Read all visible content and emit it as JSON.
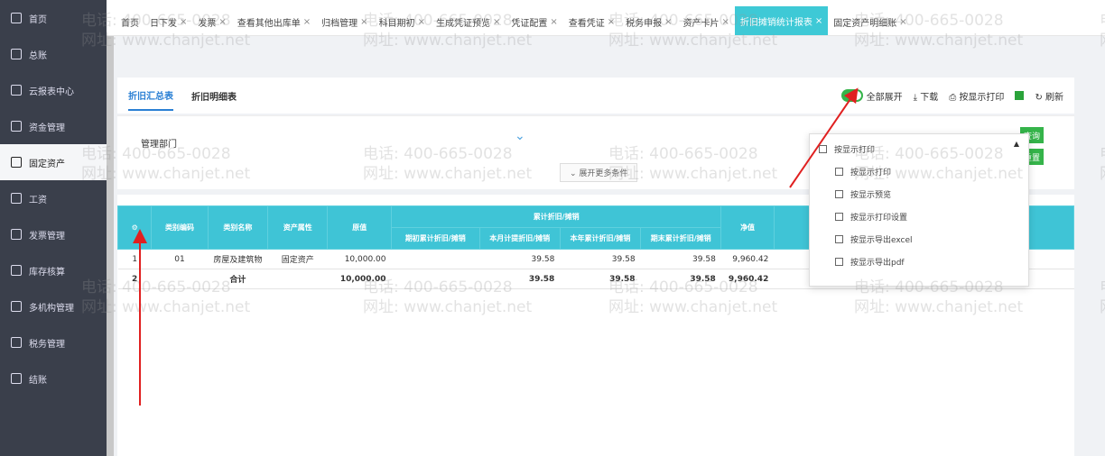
{
  "sidebar": {
    "items": [
      {
        "label": "首页",
        "icon": "home-icon",
        "active": false
      },
      {
        "label": "总账",
        "icon": "ledger-icon",
        "active": false
      },
      {
        "label": "云报表中心",
        "icon": "chart-icon",
        "active": false
      },
      {
        "label": "资金管理",
        "icon": "money-icon",
        "active": false
      },
      {
        "label": "固定资产",
        "icon": "asset-icon",
        "active": true
      },
      {
        "label": "工资",
        "icon": "salary-icon",
        "active": false
      },
      {
        "label": "发票管理",
        "icon": "invoice-icon",
        "active": false
      },
      {
        "label": "库存核算",
        "icon": "warehouse-icon",
        "active": false
      },
      {
        "label": "多机构管理",
        "icon": "org-icon",
        "active": false
      },
      {
        "label": "税务管理",
        "icon": "tax-icon",
        "active": false
      },
      {
        "label": "结账",
        "icon": "close-books-icon",
        "active": false
      }
    ]
  },
  "tabs": [
    {
      "label": "首页",
      "closable": false,
      "active": false
    },
    {
      "label": "日下发",
      "closable": true,
      "active": false
    },
    {
      "label": "发票",
      "closable": true,
      "active": false
    },
    {
      "label": "查看其他出库单",
      "closable": true,
      "active": false
    },
    {
      "label": "归档管理",
      "closable": true,
      "active": false
    },
    {
      "label": "科目期初",
      "closable": true,
      "active": false
    },
    {
      "label": "生成凭证预览",
      "closable": true,
      "active": false
    },
    {
      "label": "凭证配置",
      "closable": true,
      "active": false
    },
    {
      "label": "查看凭证",
      "closable": true,
      "active": false
    },
    {
      "label": "税务申报",
      "closable": true,
      "active": false
    },
    {
      "label": "资产卡片",
      "closable": true,
      "active": false
    },
    {
      "label": "折旧摊销统计报表",
      "closable": true,
      "active": true
    },
    {
      "label": "固定资产明细账",
      "closable": true,
      "active": false
    }
  ],
  "tab_close": "×",
  "toolbar": {
    "sub_tabs": [
      {
        "label": "折旧汇总表",
        "active": true
      },
      {
        "label": "折旧明细表",
        "active": false
      }
    ],
    "expand_all": "全部展开",
    "download": "下载",
    "print_as_shown": "按显示打印",
    "refresh": "刷新"
  },
  "filter": {
    "dept_label": "管理部门",
    "more_conditions": "展开更多条件",
    "query_button": "查询",
    "reset_button": "重置"
  },
  "table": {
    "group_header": "累计折旧/摊销",
    "columns": [
      "类别编码",
      "类别名称",
      "资产属性",
      "原值",
      "期初累计折旧/摊销",
      "本月计提折旧/摊销",
      "本年累计折旧/摊销",
      "期末累计折旧/摊销",
      "净值"
    ],
    "rows": [
      {
        "idx": "1",
        "code": "01",
        "name": "房屋及建筑物",
        "attr": "固定资产",
        "orig": "10,000.00",
        "open": "",
        "month": "39.58",
        "year": "39.58",
        "end": "39.58",
        "net": "9,960.42"
      },
      {
        "idx": "2",
        "code": "",
        "name": "合计",
        "attr": "",
        "orig": "10,000.00",
        "open": "",
        "month": "39.58",
        "year": "39.58",
        "end": "39.58",
        "net": "9,960.42"
      }
    ]
  },
  "dropdown": {
    "header": "按显示打印",
    "items": [
      "按显示打印",
      "按显示预览",
      "按显示打印设置",
      "按显示导出excel",
      "按显示导出pdf"
    ]
  },
  "watermark": {
    "phone": "电话: 400-665-0028",
    "site": "网址: www.chanjet.net"
  },
  "colors": {
    "accent": "#3ec9d6",
    "sidebar": "#3a3f4b",
    "green": "#35b44a",
    "arrow": "#e02020"
  }
}
